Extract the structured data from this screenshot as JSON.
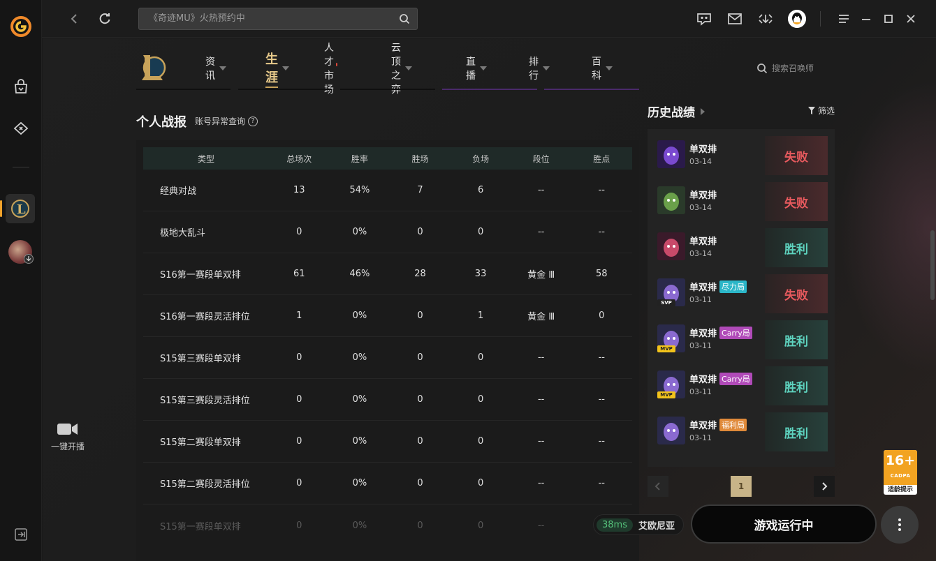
{
  "app": {
    "colors": {
      "accent": "#f3a32b",
      "win": "#5ed3bf",
      "lose": "#e85a5e",
      "gold": "#e6c98a"
    }
  },
  "topbar": {
    "search_placeholder": "《奇迹MU》火热预约中"
  },
  "sidebar": {
    "stream_label": "一键开播"
  },
  "nav": {
    "items": [
      {
        "label": "资讯"
      },
      {
        "label": "生涯"
      },
      {
        "label": "人才市场"
      },
      {
        "label": "云顶之弈"
      },
      {
        "label": "直播"
      },
      {
        "label": "排行"
      },
      {
        "label": "百科"
      }
    ],
    "summoner_search_placeholder": "搜索召唤师"
  },
  "stats": {
    "title": "个人战报",
    "subtitle": "账号异常查询",
    "columns": [
      "类型",
      "总场次",
      "胜率",
      "胜场",
      "负场",
      "段位",
      "胜点"
    ],
    "rows": [
      [
        "经典对战",
        "13",
        "54%",
        "7",
        "6",
        "--",
        "--"
      ],
      [
        "极地大乱斗",
        "0",
        "0%",
        "0",
        "0",
        "--",
        "--"
      ],
      [
        "S16第一赛段单双排",
        "61",
        "46%",
        "28",
        "33",
        "黄金 Ⅲ",
        "58"
      ],
      [
        "S16第一赛段灵活排位",
        "1",
        "0%",
        "0",
        "1",
        "黄金 Ⅲ",
        "0"
      ],
      [
        "S15第三赛段单双排",
        "0",
        "0%",
        "0",
        "0",
        "--",
        "--"
      ],
      [
        "S15第三赛段灵活排位",
        "0",
        "0%",
        "0",
        "0",
        "--",
        "--"
      ],
      [
        "S15第二赛段单双排",
        "0",
        "0%",
        "0",
        "0",
        "--",
        "--"
      ],
      [
        "S15第二赛段灵活排位",
        "0",
        "0%",
        "0",
        "0",
        "--",
        "--"
      ],
      [
        "S15第一赛段单双排",
        "0",
        "0%",
        "0",
        "0",
        "--",
        "--"
      ]
    ]
  },
  "history": {
    "title": "历史战绩",
    "filter_label": "筛选",
    "matches": [
      {
        "mode": "单双排",
        "tag": "",
        "date": "03-14",
        "result": "失败",
        "outcome": "lose",
        "badge": ""
      },
      {
        "mode": "单双排",
        "tag": "",
        "date": "03-14",
        "result": "失败",
        "outcome": "lose",
        "badge": ""
      },
      {
        "mode": "单双排",
        "tag": "",
        "date": "03-14",
        "result": "胜利",
        "outcome": "win",
        "badge": ""
      },
      {
        "mode": "单双排",
        "tag": "尽力局",
        "date": "03-11",
        "result": "失败",
        "outcome": "lose",
        "badge": "SVP"
      },
      {
        "mode": "单双排",
        "tag": "Carry局",
        "date": "03-11",
        "result": "胜利",
        "outcome": "win",
        "badge": "MVP"
      },
      {
        "mode": "单双排",
        "tag": "Carry局",
        "date": "03-11",
        "result": "胜利",
        "outcome": "win",
        "badge": "MVP"
      },
      {
        "mode": "单双排",
        "tag": "福利局",
        "date": "03-11",
        "result": "胜利",
        "outcome": "win",
        "badge": ""
      }
    ],
    "page": "1"
  },
  "rating": {
    "age": "16+",
    "org": "CADPA",
    "note": "适龄提示"
  },
  "footer": {
    "ping": "38ms",
    "server": "艾欧尼亚",
    "play_label": "游戏运行中"
  }
}
